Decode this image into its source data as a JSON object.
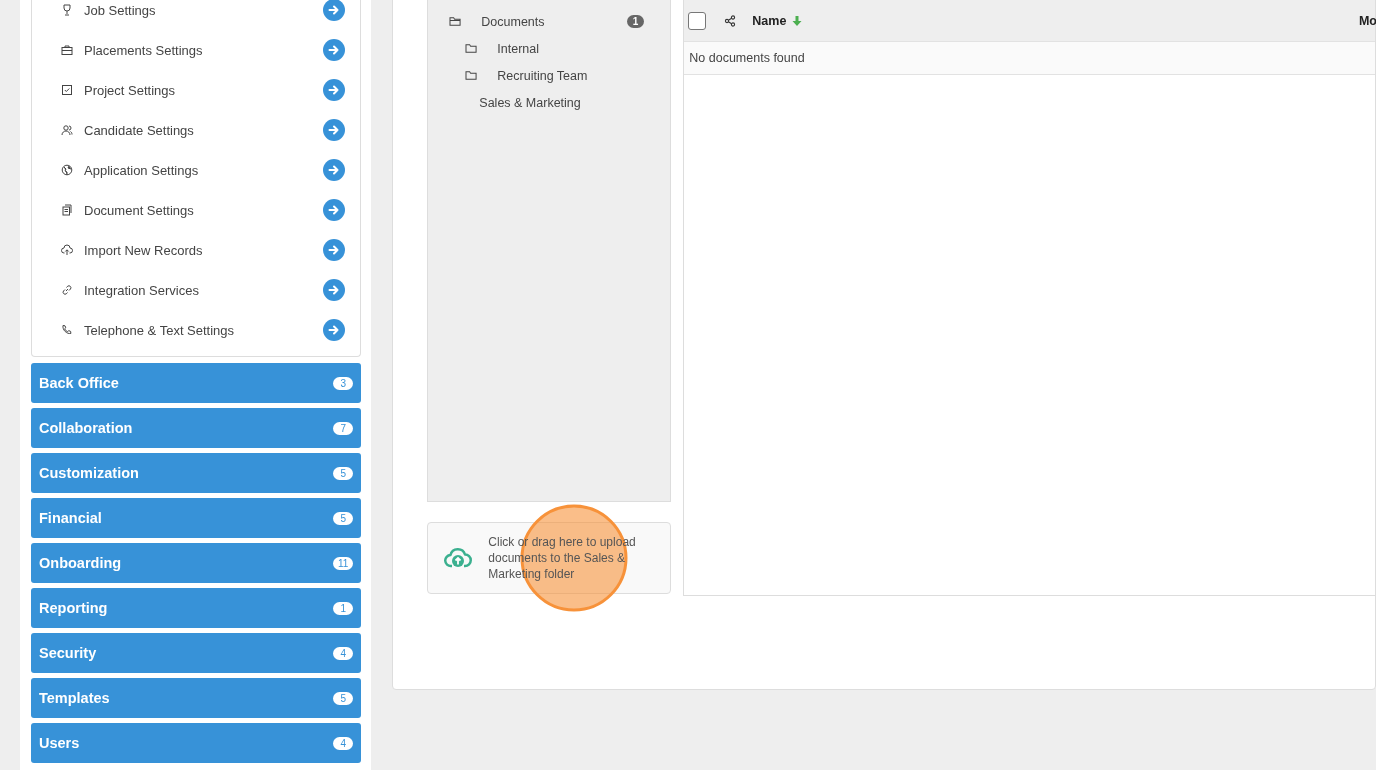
{
  "settings_list": [
    {
      "label": "Job Settings"
    },
    {
      "label": "Placements Settings"
    },
    {
      "label": "Project Settings"
    },
    {
      "label": "Candidate Settings"
    },
    {
      "label": "Application Settings"
    },
    {
      "label": "Document Settings"
    },
    {
      "label": "Import New Records"
    },
    {
      "label": "Integration Services"
    },
    {
      "label": "Telephone & Text Settings"
    }
  ],
  "categories": [
    {
      "label": "Back Office",
      "count": "3"
    },
    {
      "label": "Collaboration",
      "count": "7"
    },
    {
      "label": "Customization",
      "count": "5"
    },
    {
      "label": "Financial",
      "count": "5"
    },
    {
      "label": "Onboarding",
      "count": "11"
    },
    {
      "label": "Reporting",
      "count": "1"
    },
    {
      "label": "Security",
      "count": "4"
    },
    {
      "label": "Templates",
      "count": "5"
    },
    {
      "label": "Users",
      "count": "4"
    }
  ],
  "folder_tree": {
    "label": "Documents",
    "count": "1",
    "children": [
      {
        "label": "Internal",
        "kind": "folder"
      },
      {
        "label": "Recruiting Team",
        "kind": "folder"
      },
      {
        "label": "Sales & Marketing",
        "kind": "plain"
      }
    ]
  },
  "upload": {
    "text": "Click or drag here to upload documents to the Sales & Marketing folder"
  },
  "table": {
    "select_all_checked": false,
    "columns": [
      {
        "label": "Name",
        "sorted": true
      },
      {
        "label": "Mo",
        "sorted": false
      }
    ],
    "empty_message": "No documents found"
  }
}
